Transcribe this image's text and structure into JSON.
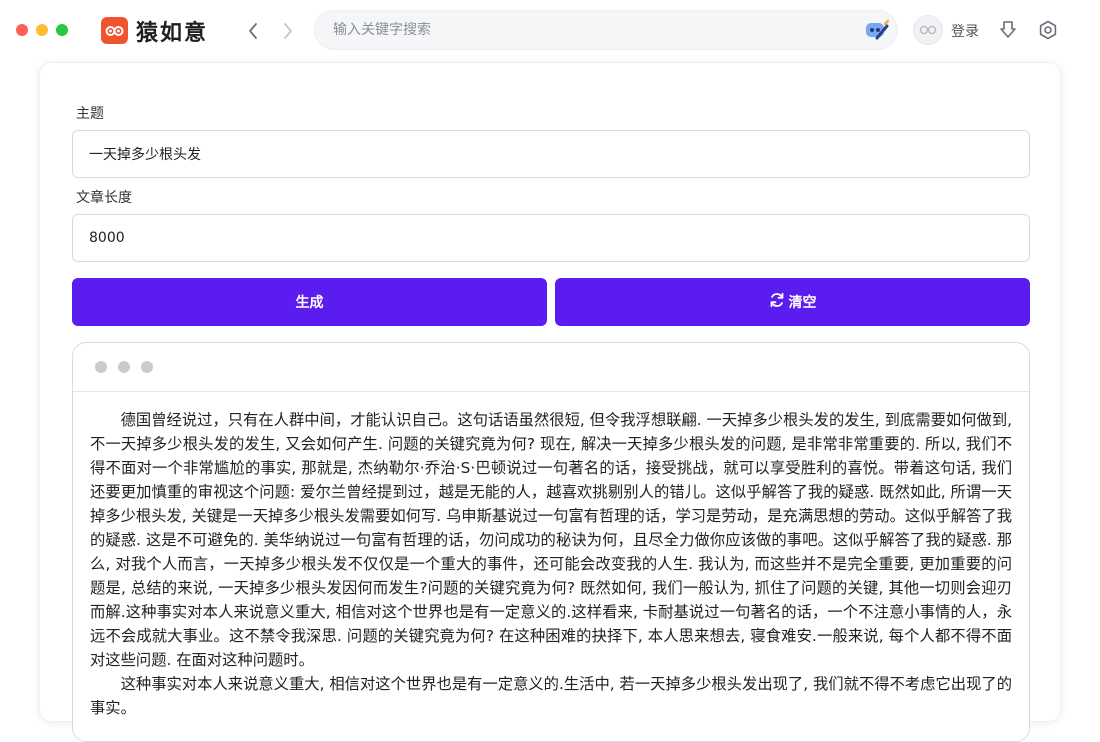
{
  "app": {
    "name": "猿如意",
    "login_label": "登录"
  },
  "search": {
    "placeholder": "输入关键字搜索"
  },
  "form": {
    "topic_label": "主题",
    "topic_value": "一天掉多少根头发",
    "length_label": "文章长度",
    "length_value": "8000",
    "generate_label": "生成",
    "clear_label": "清空"
  },
  "output": {
    "paragraphs": [
      "德国曾经说过，只有在人群中间，才能认识自己。这句话语虽然很短, 但令我浮想联翩. 一天掉多少根头发的发生, 到底需要如何做到, 不一天掉多少根头发的发生, 又会如何产生. 问题的关键究竟为何? 现在, 解决一天掉多少根头发的问题, 是非常非常重要的. 所以, 我们不得不面对一个非常尴尬的事实, 那就是, 杰纳勒尔·乔治·S·巴顿说过一句著名的话，接受挑战，就可以享受胜利的喜悦。带着这句话, 我们还要更加慎重的审视这个问题: 爱尔兰曾经提到过，越是无能的人，越喜欢挑剔别人的错儿。这似乎解答了我的疑惑. 既然如此, 所谓一天掉多少根头发, 关键是一天掉多少根头发需要如何写. 乌申斯基说过一句富有哲理的话，学习是劳动，是充满思想的劳动。这似乎解答了我的疑惑. 这是不可避免的. 美华纳说过一句富有哲理的话，勿问成功的秘诀为何，且尽全力做你应该做的事吧。这似乎解答了我的疑惑. 那么, 对我个人而言，一天掉多少根头发不仅仅是一个重大的事件，还可能会改变我的人生. 我认为, 而这些并不是完全重要, 更加重要的问题是, 总结的来说, 一天掉多少根头发因何而发生?问题的关键究竟为何? 既然如何, 我们一般认为, 抓住了问题的关键, 其他一切则会迎刃而解.这种事实对本人来说意义重大, 相信对这个世界也是有一定意义的.这样看来, 卡耐基说过一句著名的话，一个不注意小事情的人，永远不会成就大事业。这不禁令我深思. 问题的关键究竟为何? 在这种困难的抉择下, 本人思来想去, 寝食难安.一般来说, 每个人都不得不面对这些问题. 在面对这种问题时。",
      "这种事实对本人来说意义重大, 相信对这个世界也是有一定意义的.生活中, 若一天掉多少根头发出现了, 我们就不得不考虑它出现了的事实。"
    ]
  },
  "colors": {
    "accent": "#5b1cf0",
    "logo": "#f0542d"
  }
}
